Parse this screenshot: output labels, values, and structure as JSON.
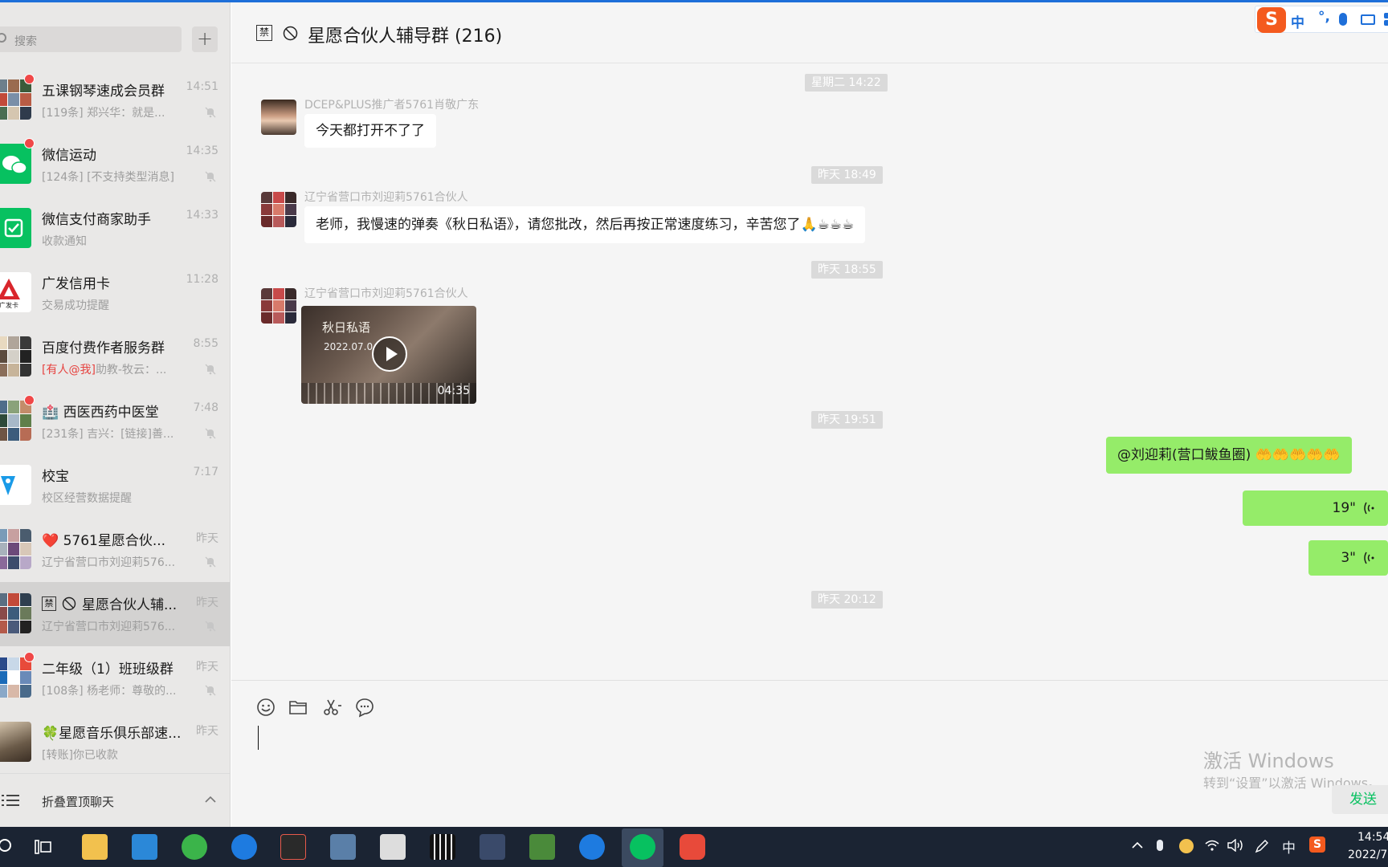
{
  "sidebar": {
    "search_placeholder": "搜索",
    "add_label": "+",
    "chats": [
      {
        "name": "五课钢琴速成会员群",
        "time": "14:51",
        "preview": "[119条] 郑兴华：就是...",
        "unread": true,
        "muted": true
      },
      {
        "name": "微信运动",
        "time": "14:35",
        "preview": "[124条] [不支持类型消息]",
        "unread": true,
        "muted": true
      },
      {
        "name": "微信支付商家助手",
        "time": "14:33",
        "preview": "收款通知",
        "unread": false,
        "muted": false
      },
      {
        "name": "广发信用卡",
        "time": "11:28",
        "preview": "交易成功提醒",
        "unread": false,
        "muted": false,
        "avatar_text": "广发卡"
      },
      {
        "name": "百度付费作者服务群",
        "time": "8:55",
        "preview_mention": "[有人@我]",
        "preview": "助教-牧云：...",
        "unread": false,
        "muted": true
      },
      {
        "name": "🏥 西医西药中医堂",
        "time": "7:48",
        "preview": "[231条] 吉兴：[链接]善...",
        "unread": true,
        "muted": true
      },
      {
        "name": "校宝",
        "time": "7:17",
        "preview": "校区经营数据提醒",
        "unread": false,
        "muted": false
      },
      {
        "name": "❤️ 5761星愿合伙...",
        "time": "昨天",
        "preview": "辽宁省营口市刘迎莉576...",
        "unread": false,
        "muted": true
      },
      {
        "name": "星愿合伙人辅...",
        "jin": "禁",
        "time": "昨天",
        "preview": "辽宁省营口市刘迎莉576...",
        "unread": false,
        "muted": true,
        "active": true
      },
      {
        "name": "二年级（1）班班级群",
        "time": "昨天",
        "preview": "[108条] 杨老师：尊敬的...",
        "unread": true,
        "muted": true
      },
      {
        "name": "🍀星愿音乐俱乐部速...",
        "time": "昨天",
        "preview": "[转账]你已收款",
        "unread": false,
        "muted": false
      }
    ],
    "fold_label": "折叠置顶聊天"
  },
  "header": {
    "jin": "禁",
    "title": "星愿合伙人辅导群 (216)"
  },
  "ime": {
    "logo": "S",
    "lang": "中",
    "punct": "°,"
  },
  "messages": {
    "ts1": "星期二 14:22",
    "m1_sender": "DCEP&PLUS推广者5761肖敬广东",
    "m1_text": "今天都打开不了了",
    "ts2": "昨天 18:49",
    "m2_sender": "辽宁省营口市刘迎莉5761合伙人",
    "m2_text": "老师，我慢速的弹奏《秋日私语》，请您批改，然后再按正常速度练习，辛苦您了🙏☕☕☕",
    "ts3": "昨天 18:55",
    "m3_sender": "辽宁省营口市刘迎莉5761合伙人",
    "video_title": "秋日私语",
    "video_date": "2022.07.0",
    "video_duration": "04:35",
    "ts4": "昨天 19:51",
    "out1_text": "@刘迎莉(营口鲅鱼圈) 🤲🤲🤲🤲🤲",
    "out2_voice": "19\"",
    "out3_voice": "3\"",
    "ts5": "昨天 20:12"
  },
  "input": {
    "watermark_title": "激活 Windows",
    "watermark_sub": "转到“设置”以激活 Windows。",
    "send_label": "发送"
  },
  "taskbar": {
    "tray_lang": "中",
    "time": "14:54",
    "date": "2022/7"
  },
  "colors": {
    "accent_green": "#95ec69",
    "wechat_green": "#07c160",
    "badge_red": "#f04848",
    "taskbar": "#1b2433"
  }
}
